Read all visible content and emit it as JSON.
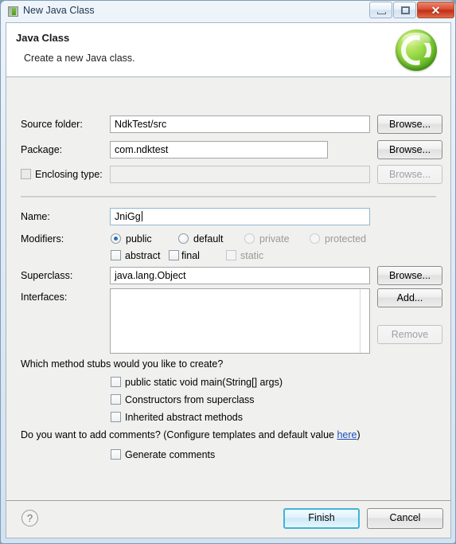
{
  "window": {
    "title": "New Java Class",
    "icon": "java-class-icon",
    "controls": {
      "minimize": "minimize-button",
      "maximize": "maximize-button",
      "close": "✕"
    }
  },
  "header": {
    "title": "Java Class",
    "subtitle": "Create a new Java class.",
    "logo": "green-c-badge-icon"
  },
  "form": {
    "source_folder": {
      "label": "Source folder:",
      "value": "NdkTest/src",
      "placeholder": "",
      "browse": "Browse..."
    },
    "package": {
      "label": "Package:",
      "value": "com.ndktest",
      "placeholder": "",
      "browse": "Browse..."
    },
    "enclosing_type": {
      "label": "Enclosing type:",
      "value": "",
      "placeholder": "",
      "browse": "Browse...",
      "checked": false,
      "enabled": false
    },
    "name": {
      "label": "Name:",
      "value": "JniGg",
      "placeholder": "",
      "focused": true
    },
    "modifiers": {
      "label": "Modifiers:",
      "radios": [
        {
          "label": "public",
          "selected": true,
          "enabled": true
        },
        {
          "label": "default",
          "selected": false,
          "enabled": true
        },
        {
          "label": "private",
          "selected": false,
          "enabled": false
        },
        {
          "label": "protected",
          "selected": false,
          "enabled": false
        }
      ],
      "checkboxes": [
        {
          "label": "abstract",
          "checked": false,
          "enabled": true
        },
        {
          "label": "final",
          "checked": false,
          "enabled": true
        },
        {
          "label": "static",
          "checked": false,
          "enabled": false
        }
      ]
    },
    "superclass": {
      "label": "Superclass:",
      "value": "java.lang.Object",
      "placeholder": "",
      "browse": "Browse..."
    },
    "interfaces": {
      "label": "Interfaces:",
      "items": [],
      "add": "Add...",
      "remove": "Remove",
      "remove_enabled": false
    }
  },
  "stubs": {
    "question": "Which method stubs would you like to create?",
    "options": [
      {
        "label": "public static void main(String[] args)",
        "checked": false
      },
      {
        "label": "Constructors from superclass",
        "checked": false
      },
      {
        "label": "Inherited abstract methods",
        "checked": false
      }
    ]
  },
  "comments": {
    "question_prefix": "Do you want to add comments? (Configure templates and default value ",
    "link": "here",
    "question_suffix": ")",
    "option": {
      "label": "Generate comments",
      "checked": false
    }
  },
  "footer": {
    "help": "?",
    "finish": "Finish",
    "cancel": "Cancel"
  },
  "colors": {
    "accent": "#3fb4d6",
    "link": "#1a4fbd",
    "radio_dot": "#2b6fb5",
    "logo_green": "#5fb321"
  }
}
